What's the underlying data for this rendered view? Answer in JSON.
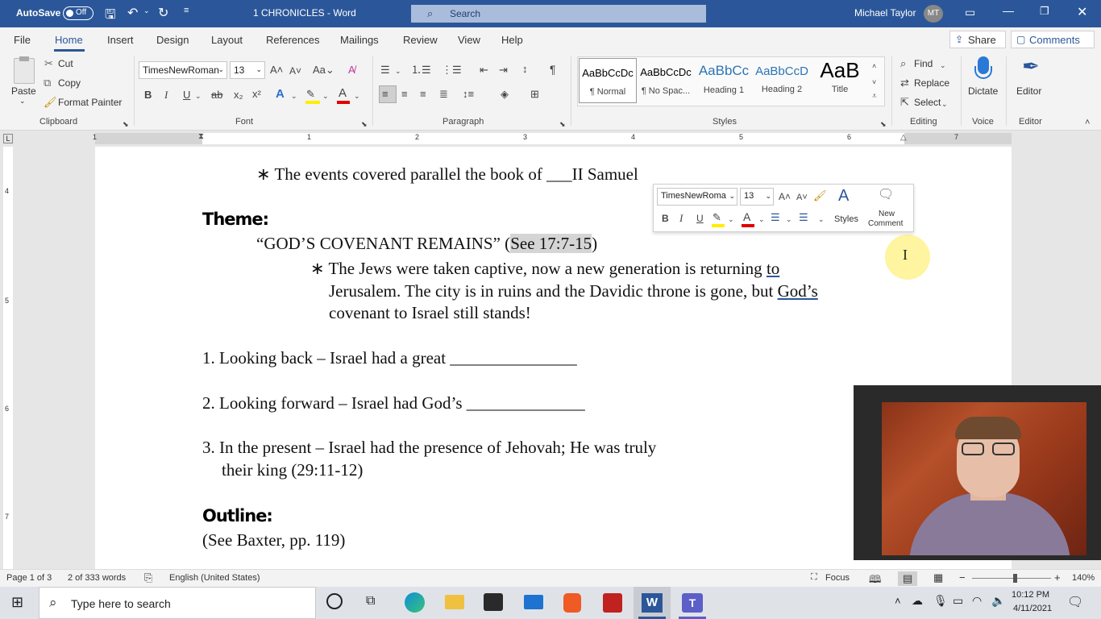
{
  "titlebar": {
    "autosave_label": "AutoSave",
    "autosave_state": "Off",
    "doc_title": "1 CHRONICLES  -  Word",
    "search_placeholder": "Search",
    "user_name": "Michael Taylor",
    "user_initials": "MT",
    "bg_color": "#2b579a"
  },
  "menubar": {
    "items": [
      "File",
      "Home",
      "Insert",
      "Design",
      "Layout",
      "References",
      "Mailings",
      "Review",
      "View",
      "Help"
    ],
    "active": "Home",
    "share_label": "Share",
    "comments_label": "Comments"
  },
  "ribbon": {
    "clipboard": {
      "paste": "Paste",
      "cut": "Cut",
      "copy": "Copy",
      "format_painter": "Format Painter",
      "label": "Clipboard"
    },
    "font": {
      "family": "TimesNewRoman",
      "size": "13",
      "label": "Font"
    },
    "paragraph": {
      "label": "Paragraph"
    },
    "styles": {
      "items": [
        {
          "preview": "AaBbCcDc",
          "name": "¶ Normal"
        },
        {
          "preview": "AaBbCcDc",
          "name": "¶ No Spac..."
        },
        {
          "preview": "AaBbCc",
          "name": "Heading 1"
        },
        {
          "preview": "AaBbCcD",
          "name": "Heading 2"
        },
        {
          "preview": "AaB",
          "name": "Title"
        }
      ],
      "label": "Styles"
    },
    "editing": {
      "find": "Find",
      "replace": "Replace",
      "select": "Select",
      "label": "Editing"
    },
    "voice": {
      "dictate": "Dictate",
      "label": "Voice"
    },
    "editor": {
      "editor": "Editor",
      "label": "Editor"
    }
  },
  "ruler": {
    "numbers": [
      "1",
      "1",
      "2",
      "3",
      "4",
      "5",
      "6",
      "7"
    ]
  },
  "vruler": {
    "numbers": [
      "4",
      "5",
      "6",
      "7"
    ]
  },
  "document": {
    "line1": "∗ The events covered parallel the book of ___II Samuel",
    "theme_heading": "Theme:",
    "theme_line": "“GOD’S COVENANT REMAINS” (",
    "theme_ref": "See 17:7-15",
    "theme_close": ")",
    "bullet_a": "∗ The Jews were taken captive, now a new generation is returning ",
    "bullet_a_link": "to",
    "bullet_b": "Jerusalem. The city is in ruins and the Davidic throne is gone, but ",
    "bullet_b_link": "God’s",
    "bullet_c": "covenant to Israel still stands!",
    "item1": "1. Looking back – Israel had a great _______________",
    "item2": "2. Looking forward – Israel had God’s ______________",
    "item3a": "3. In the present – Israel had the presence of Jehovah; He was truly",
    "item3b": "their king (29:11-12)",
    "outline_heading": "Outline:",
    "outline_line": "(See Baxter, pp. 119)"
  },
  "mini_toolbar": {
    "font": "TimesNewRoma",
    "size": "13",
    "styles_label": "Styles",
    "new_comment": "New",
    "new_comment2": "Comment"
  },
  "status": {
    "page": "Page 1 of 3",
    "words": "2 of 333 words",
    "language": "English (United States)",
    "focus": "Focus",
    "zoom": "140%"
  },
  "taskbar": {
    "search_placeholder": "Type here to search",
    "time": "10:12 PM",
    "date": "4/11/2021"
  }
}
